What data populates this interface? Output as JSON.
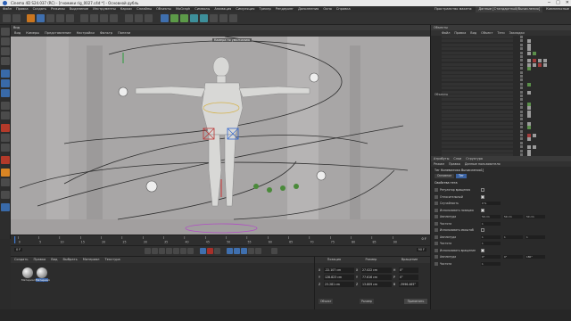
{
  "window": {
    "title": "Cinema 4D S24.037 (RC) - [гномики rig_0027.c4d *] - Основной дубль",
    "controls": [
      "─",
      "□",
      "✕"
    ]
  },
  "menubar": {
    "items": [
      "Файл",
      "Правка",
      "Создать",
      "Режимы",
      "Выделение",
      "Инструменты",
      "Каркас",
      "Сплайны",
      "Объекты",
      "MoGraph",
      "Символы",
      "Анимация",
      "Симуляция",
      "Трекер",
      "Рендеринг",
      "Дополнения",
      "Окно",
      "Справка"
    ],
    "right_label": "Пространство макета:",
    "layout_value": "Данные [Стандартный/Вычисления]",
    "mode_label": "Комплексные"
  },
  "viewport": {
    "panel_title": "Вид",
    "menu": [
      "Вид",
      "Камеры",
      "Представление",
      "Настройки",
      "Фильтр",
      "Панели"
    ],
    "camera_label": "Камера по умолчанию",
    "background": "#a8a6a6"
  },
  "timeline": {
    "ticks": [
      "0",
      "5",
      "10",
      "15",
      "20",
      "25",
      "30",
      "35",
      "40",
      "45",
      "50",
      "55",
      "60",
      "65",
      "70",
      "75",
      "80",
      "85",
      "90"
    ],
    "current_frame": "0 F",
    "end_field": "90 F",
    "min_field": "0 F",
    "max_field": "90 F"
  },
  "materials": {
    "menu": [
      "Создать",
      "Правка",
      "Вид",
      "Выбрать",
      "Материал",
      "Текстура"
    ],
    "items": [
      {
        "name": "Материал"
      },
      {
        "name": "Материал",
        "selected": true
      }
    ]
  },
  "coordinates": {
    "headers": [
      "Позиция",
      "Размер",
      "Вращение"
    ],
    "rows": [
      {
        "axis": "X",
        "pos": "-22.107 cm",
        "size": "27.022 cm",
        "rot_axis": "H",
        "rot": "0°"
      },
      {
        "axis": "Y",
        "pos": "128.823 cm",
        "size": "77.616 cm",
        "rot_axis": "P",
        "rot": "0°"
      },
      {
        "axis": "Z",
        "pos": "23.281 cm",
        "size": "13.809 cm",
        "rot_axis": "B",
        "rot": "-3996.465°"
      }
    ],
    "mode_object": "Объект",
    "mode_size": "Размер",
    "apply_label": "Применить"
  },
  "object_manager": {
    "title": "Объекты",
    "menu": [
      "Файл",
      "Правка",
      "Вид",
      "Объект",
      "Теги",
      "Закладки"
    ],
    "item_label": "Объекты"
  },
  "attributes": {
    "tabs_header": [
      "Атрибуты",
      "Слои",
      "Структура"
    ],
    "menu": [
      "Режим",
      "Правка",
      "Данные пользователя"
    ],
    "tag_title": "Тег Кинематика Вычисления1]",
    "tabs": [
      "Основное",
      "Тег"
    ],
    "active_tab": "Тег",
    "section": "Свойства тега",
    "props": [
      {
        "label": "Регулятор вращения",
        "checked": false
      },
      {
        "label": "Относительный",
        "checked": true
      },
      {
        "label": "Случайность",
        "value": "0 %"
      },
      {
        "label": "Использовать позицию",
        "checked": true
      },
      {
        "label": "Амплитуда",
        "values": [
          "50 cm",
          "50 cm",
          "50 cm"
        ]
      },
      {
        "label": "Частота",
        "value": "1"
      },
      {
        "label": "Использовать масштаб",
        "checked": false
      },
      {
        "label": "Амплитуда",
        "values": [
          "1",
          "1",
          "1"
        ]
      },
      {
        "label": "Частота",
        "value": "1"
      },
      {
        "label": "Использовать вращение",
        "checked": true
      },
      {
        "label": "Амплитуда",
        "values": [
          "0°",
          "0°",
          "180°"
        ]
      },
      {
        "label": "Частота",
        "value": "1"
      }
    ]
  },
  "colors": {
    "accent": "#3b63a3",
    "viewport_bg": "#a8a6a6",
    "spline": "#2f2f2f",
    "selection": "#d4b24a"
  }
}
